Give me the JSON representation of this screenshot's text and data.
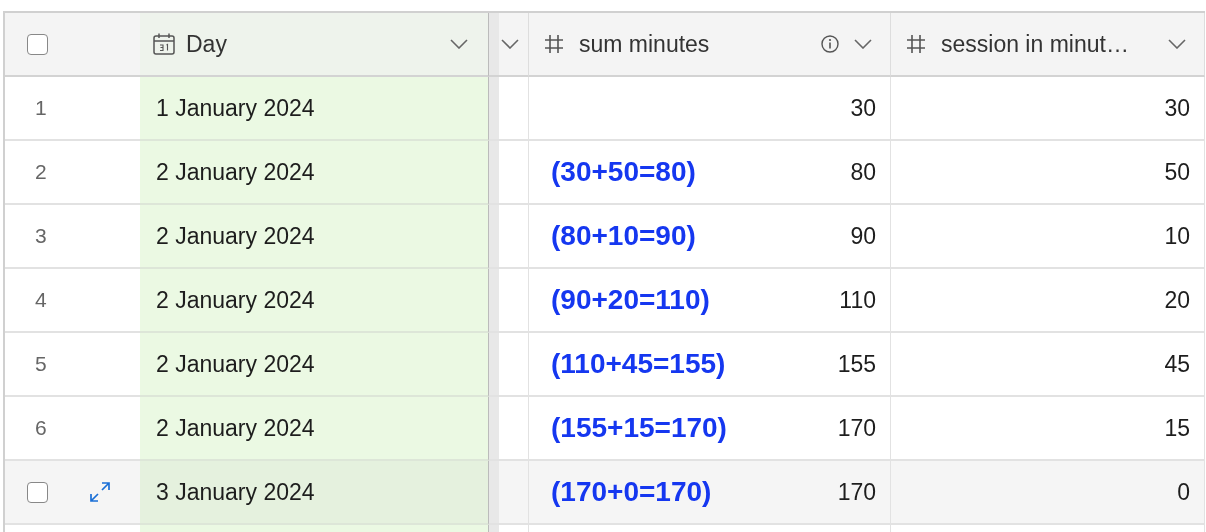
{
  "header": {
    "select_all": {
      "checked": false
    },
    "columns": [
      {
        "kind": "date",
        "label": "Day"
      },
      {
        "kind": "blank"
      },
      {
        "kind": "number",
        "label": "sum minutes",
        "info": true
      },
      {
        "kind": "number",
        "label": "session in minut…",
        "info": false
      }
    ]
  },
  "rows": [
    {
      "number": "1",
      "day": "1 January 2024",
      "sum": "30",
      "session": "30",
      "hovered": false
    },
    {
      "number": "2",
      "day": "2 January 2024",
      "annotation": "(30+50=80)",
      "sum": "80",
      "session": "50",
      "hovered": false
    },
    {
      "number": "3",
      "day": "2 January 2024",
      "annotation": "(80+10=90)",
      "sum": "90",
      "session": "10",
      "hovered": false
    },
    {
      "number": "4",
      "day": "2 January 2024",
      "annotation": "(90+20=110)",
      "sum": "110",
      "session": "20",
      "hovered": false
    },
    {
      "number": "5",
      "day": "2 January 2024",
      "annotation": "(110+45=155)",
      "sum": "155",
      "session": "45",
      "hovered": false
    },
    {
      "number": "6",
      "day": "2 January 2024",
      "annotation": "(155+15=170)",
      "sum": "170",
      "session": "15",
      "hovered": false
    },
    {
      "day": "3 January 2024",
      "annotation": "(170+0=170)",
      "sum": "170",
      "session": "0",
      "hovered": true,
      "checked": false
    }
  ]
}
